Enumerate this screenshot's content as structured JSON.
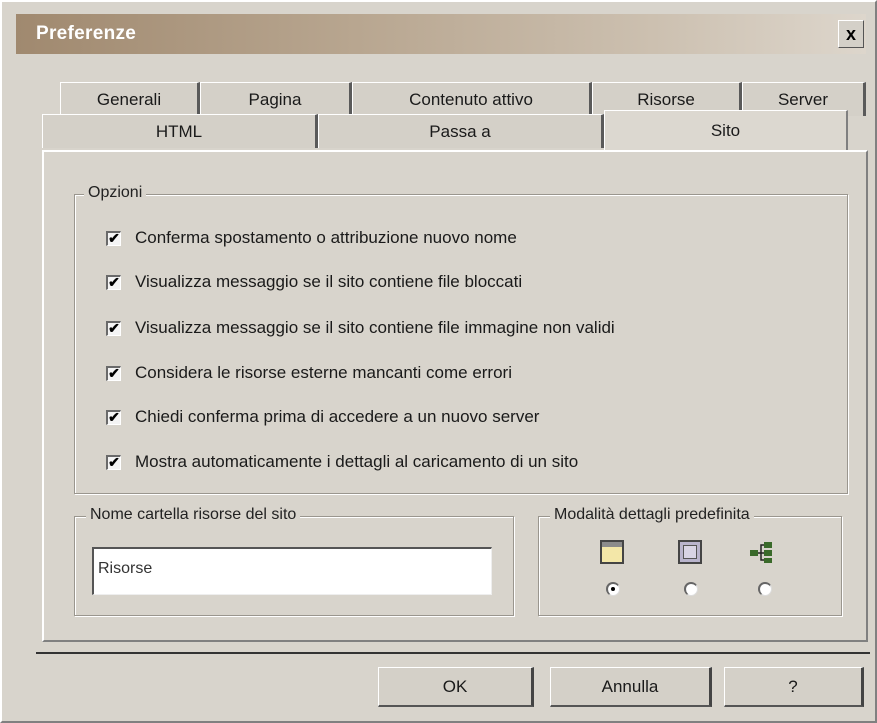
{
  "window": {
    "title": "Preferenze"
  },
  "tabs": {
    "back_row": [
      "Generali",
      "Pagina",
      "Contenuto attivo",
      "Risorse",
      "Server"
    ],
    "front_row": [
      "HTML",
      "Passa a",
      "Sito"
    ],
    "selected": "Sito"
  },
  "options_group": {
    "label": "Opzioni",
    "items": [
      {
        "label": "Conferma spostamento o attribuzione nuovo nome",
        "checked": true
      },
      {
        "label": "Visualizza messaggio se il sito contiene file bloccati",
        "checked": true
      },
      {
        "label": "Visualizza messaggio se il sito contiene file immagine non validi",
        "checked": true
      },
      {
        "label": "Considera le risorse esterne mancanti come errori",
        "checked": true
      },
      {
        "label": "Chiedi conferma prima di accedere a un nuovo server",
        "checked": true
      },
      {
        "label": "Mostra automaticamente i dettagli al caricamento di un sito",
        "checked": true
      }
    ],
    "check_glyph": "✔"
  },
  "resource_folder": {
    "label": "Nome cartella risorse del sito",
    "value": "Risorse"
  },
  "details_mode": {
    "label": "Modalità dettagli predefinita",
    "icons": [
      "window-view-icon",
      "list-view-icon",
      "tree-view-icon"
    ],
    "selected_index": 0
  },
  "buttons": {
    "ok": "OK",
    "cancel": "Annulla",
    "help": "?"
  },
  "close_glyph": "x"
}
